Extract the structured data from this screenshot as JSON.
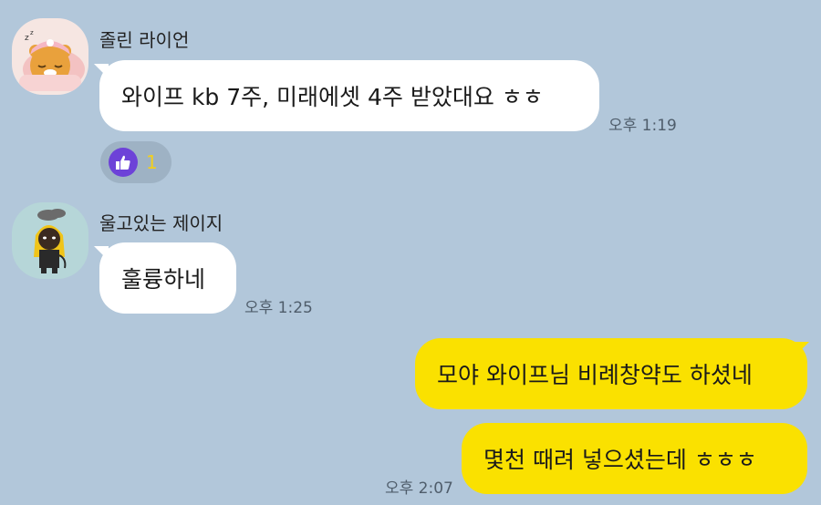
{
  "colors": {
    "background": "#b2c7da",
    "incoming_bubble": "#ffffff",
    "outgoing_bubble": "#fae100",
    "reaction_icon": "#6d42d8",
    "reaction_count": "#f2cf1d"
  },
  "messages": [
    {
      "sender": "졸린 라이언",
      "avatar_icon": "sleeping-ryan-avatar-icon",
      "text": "와이프 kb 7주, 미래에셋 4주 받았대요 ㅎㅎ",
      "time": "오후 1:19",
      "reaction": {
        "icon": "thumbs-up-icon",
        "count": "1"
      }
    },
    {
      "sender": "울고있는 제이지",
      "avatar_icon": "crying-jayg-avatar-icon",
      "text": "훌륭하네",
      "time": "오후 1:25"
    },
    {
      "text": "모야 와이프님 비례창약도 하셨네"
    },
    {
      "text": "몇천 때려 넣으셨는데 ㅎㅎㅎ",
      "time": "오후 2:07"
    }
  ]
}
